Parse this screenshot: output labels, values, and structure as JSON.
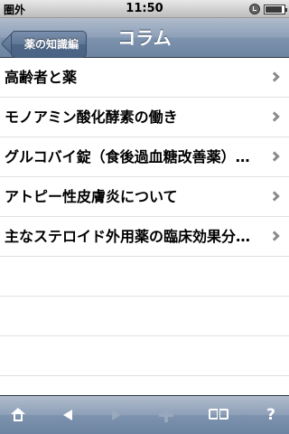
{
  "status_bar": {
    "carrier": "圏外",
    "time": "11:50",
    "icons": [
      "orientation-lock-icon",
      "battery-icon"
    ]
  },
  "nav_bar": {
    "back_label": "薬の知識編",
    "title": "コラム"
  },
  "list": {
    "items": [
      {
        "label": "高齢者と薬"
      },
      {
        "label": "モノアミン酸化酵素の働き"
      },
      {
        "label": "グルコバイ錠（食後過血糖改善薬）…"
      },
      {
        "label": "アトピー性皮膚炎について"
      },
      {
        "label": "主なステロイド外用薬の臨床効果分…"
      }
    ]
  },
  "toolbar": {
    "icons": [
      "home-icon",
      "back-arrow-icon",
      "forward-arrow-icon",
      "add-icon",
      "bookmarks-icon",
      "help-icon"
    ],
    "help_label": "?"
  },
  "colors": {
    "bar_blue": "#6d84a2",
    "separator": "#e0e0e0",
    "chevron": "#8a8a8a"
  }
}
